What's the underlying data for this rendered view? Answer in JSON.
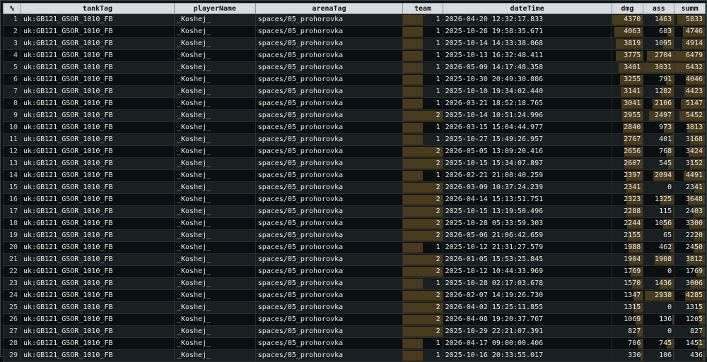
{
  "table": {
    "headers": [
      "%",
      "tankTag",
      "playerName",
      "arenaTag",
      "team",
      "dateTime",
      "dmg",
      "ass",
      "summ"
    ],
    "max": {
      "team": 2,
      "dmg": 4370,
      "ass": 3031,
      "summ": 6479
    },
    "rows": [
      {
        "idx": "1",
        "tank": "uk:GB121_GSOR_1010_FB",
        "player": "_Koshej_",
        "arena": "spaces/05_prohorovka",
        "team": "1",
        "date": "2026-04-20 12:32:17.833",
        "dmg": "4370",
        "ass": "1463",
        "summ": "5833"
      },
      {
        "idx": "2",
        "tank": "uk:GB121_GSOR_1010_FB",
        "player": "_Koshej_",
        "arena": "spaces/05_prohorovka",
        "team": "1",
        "date": "2025-10-28 19:58:35.671",
        "dmg": "4063",
        "ass": "683",
        "summ": "4746"
      },
      {
        "idx": "3",
        "tank": "uk:GB121_GSOR_1010_FB",
        "player": "_Koshej_",
        "arena": "spaces/05_prohorovka",
        "team": "1",
        "date": "2025-10-14 14:33:38.068",
        "dmg": "3819",
        "ass": "1095",
        "summ": "4914"
      },
      {
        "idx": "4",
        "tank": "uk:GB121_GSOR_1010_FB",
        "player": "_Koshej_",
        "arena": "spaces/05_prohorovka",
        "team": "1",
        "date": "2025-10-13 16:32:48.411",
        "dmg": "3775",
        "ass": "2704",
        "summ": "6479"
      },
      {
        "idx": "5",
        "tank": "uk:GB121_GSOR_1010_FB",
        "player": "_Koshej_",
        "arena": "spaces/05_prohorovka",
        "team": "1",
        "date": "2026-05-09 14:17:48.358",
        "dmg": "3401",
        "ass": "3031",
        "summ": "6432"
      },
      {
        "idx": "6",
        "tank": "uk:GB121_GSOR_1010_FB",
        "player": "_Koshej_",
        "arena": "spaces/05_prohorovka",
        "team": "1",
        "date": "2025-10-30 20:49:30.886",
        "dmg": "3255",
        "ass": "791",
        "summ": "4046"
      },
      {
        "idx": "7",
        "tank": "uk:GB121_GSOR_1010_FB",
        "player": "_Koshej_",
        "arena": "spaces/05_prohorovka",
        "team": "1",
        "date": "2025-10-10 19:34:02.440",
        "dmg": "3141",
        "ass": "1282",
        "summ": "4423"
      },
      {
        "idx": "8",
        "tank": "uk:GB121_GSOR_1010_FB",
        "player": "_Koshej_",
        "arena": "spaces/05_prohorovka",
        "team": "1",
        "date": "2026-03-21 18:52:18.765",
        "dmg": "3041",
        "ass": "2106",
        "summ": "5147"
      },
      {
        "idx": "9",
        "tank": "uk:GB121_GSOR_1010_FB",
        "player": "_Koshej_",
        "arena": "spaces/05_prohorovka",
        "team": "2",
        "date": "2025-10-14 10:51:24.996",
        "dmg": "2955",
        "ass": "2497",
        "summ": "5452"
      },
      {
        "idx": "10",
        "tank": "uk:GB121_GSOR_1010_FB",
        "player": "_Koshej_",
        "arena": "spaces/05_prohorovka",
        "team": "1",
        "date": "2026-03-15 15:04:44.977",
        "dmg": "2840",
        "ass": "973",
        "summ": "3813"
      },
      {
        "idx": "11",
        "tank": "uk:GB121_GSOR_1010_FB",
        "player": "_Koshej_",
        "arena": "spaces/05_prohorovka",
        "team": "1",
        "date": "2025-10-27 15:49:26.957",
        "dmg": "2767",
        "ass": "401",
        "summ": "3168"
      },
      {
        "idx": "12",
        "tank": "uk:GB121_GSOR_1010_FB",
        "player": "_Koshej_",
        "arena": "spaces/05_prohorovka",
        "team": "2",
        "date": "2026-05-05 13:09:20.416",
        "dmg": "2656",
        "ass": "768",
        "summ": "3424"
      },
      {
        "idx": "13",
        "tank": "uk:GB121_GSOR_1010_FB",
        "player": "_Koshej_",
        "arena": "spaces/05_prohorovka",
        "team": "2",
        "date": "2025-10-15 15:34:07.897",
        "dmg": "2607",
        "ass": "545",
        "summ": "3152"
      },
      {
        "idx": "14",
        "tank": "uk:GB121_GSOR_1010_FB",
        "player": "_Koshej_",
        "arena": "spaces/05_prohorovka",
        "team": "1",
        "date": "2026-02-21 21:08:40.259",
        "dmg": "2397",
        "ass": "2094",
        "summ": "4491"
      },
      {
        "idx": "15",
        "tank": "uk:GB121_GSOR_1010_FB",
        "player": "_Koshej_",
        "arena": "spaces/05_prohorovka",
        "team": "2",
        "date": "2026-03-09 10:37:24.239",
        "dmg": "2341",
        "ass": "0",
        "summ": "2341"
      },
      {
        "idx": "16",
        "tank": "uk:GB121_GSOR_1010_FB",
        "player": "_Koshej_",
        "arena": "spaces/05_prohorovka",
        "team": "2",
        "date": "2026-04-14 15:13:51.751",
        "dmg": "2323",
        "ass": "1325",
        "summ": "3648"
      },
      {
        "idx": "17",
        "tank": "uk:GB121_GSOR_1010_FB",
        "player": "_Koshej_",
        "arena": "spaces/05_prohorovka",
        "team": "2",
        "date": "2025-10-15 13:19:50.496",
        "dmg": "2288",
        "ass": "115",
        "summ": "2403"
      },
      {
        "idx": "18",
        "tank": "uk:GB121_GSOR_1010_FB",
        "player": "_Koshej_",
        "arena": "spaces/05_prohorovka",
        "team": "2",
        "date": "2025-10-28 05:33:59.303",
        "dmg": "2244",
        "ass": "1056",
        "summ": "3300"
      },
      {
        "idx": "19",
        "tank": "uk:GB121_GSOR_1010_FB",
        "player": "_Koshej_",
        "arena": "spaces/05_prohorovka",
        "team": "2",
        "date": "2026-05-06 21:06:42.659",
        "dmg": "2155",
        "ass": "65",
        "summ": "2220"
      },
      {
        "idx": "20",
        "tank": "uk:GB121_GSOR_1010_FB",
        "player": "_Koshej_",
        "arena": "spaces/05_prohorovka",
        "team": "1",
        "date": "2025-10-12 21:31:27.579",
        "dmg": "1988",
        "ass": "462",
        "summ": "2450"
      },
      {
        "idx": "21",
        "tank": "uk:GB121_GSOR_1010_FB",
        "player": "_Koshej_",
        "arena": "spaces/05_prohorovka",
        "team": "2",
        "date": "2026-01-05 15:53:25.845",
        "dmg": "1904",
        "ass": "1908",
        "summ": "3812"
      },
      {
        "idx": "22",
        "tank": "uk:GB121_GSOR_1010_FB",
        "player": "_Koshej_",
        "arena": "spaces/05_prohorovka",
        "team": "2",
        "date": "2025-10-12 10:44:33.969",
        "dmg": "1769",
        "ass": "0",
        "summ": "1769"
      },
      {
        "idx": "23",
        "tank": "uk:GB121_GSOR_1010_FB",
        "player": "_Koshej_",
        "arena": "spaces/05_prohorovka",
        "team": "1",
        "date": "2025-10-28 02:17:03.678",
        "dmg": "1570",
        "ass": "1436",
        "summ": "3006"
      },
      {
        "idx": "24",
        "tank": "uk:GB121_GSOR_1010_FB",
        "player": "_Koshej_",
        "arena": "spaces/05_prohorovka",
        "team": "2",
        "date": "2026-02-07 14:19:26.730",
        "dmg": "1347",
        "ass": "2938",
        "summ": "4285"
      },
      {
        "idx": "25",
        "tank": "uk:GB121_GSOR_1010_FB",
        "player": "_Koshej_",
        "arena": "spaces/05_prohorovka",
        "team": "2",
        "date": "2026-04-02 15:25:11.855",
        "dmg": "1315",
        "ass": "0",
        "summ": "1315"
      },
      {
        "idx": "26",
        "tank": "uk:GB121_GSOR_1010_FB",
        "player": "_Koshej_",
        "arena": "spaces/05_prohorovka",
        "team": "2",
        "date": "2026-04-08 19:20:37.767",
        "dmg": "1069",
        "ass": "136",
        "summ": "1205"
      },
      {
        "idx": "27",
        "tank": "uk:GB121_GSOR_1010_FB",
        "player": "_Koshej_",
        "arena": "spaces/05_prohorovka",
        "team": "2",
        "date": "2025-10-29 22:21:07.391",
        "dmg": "827",
        "ass": "0",
        "summ": "827"
      },
      {
        "idx": "28",
        "tank": "uk:GB121_GSOR_1010_FB",
        "player": "_Koshej_",
        "arena": "spaces/05_prohorovka",
        "team": "1",
        "date": "2026-04-17 09:00:00.406",
        "dmg": "706",
        "ass": "745",
        "summ": "1451"
      },
      {
        "idx": "29",
        "tank": "uk:GB121_GSOR_1010_FB",
        "player": "_Koshej_",
        "arena": "spaces/05_prohorovka",
        "team": "1",
        "date": "2025-10-16 20:33:55.017",
        "dmg": "330",
        "ass": "106",
        "summ": "436"
      }
    ]
  },
  "colors": {
    "bar": "#4a3b1c",
    "header_bg": "#d6dcdf",
    "text": "#e8ece6"
  }
}
